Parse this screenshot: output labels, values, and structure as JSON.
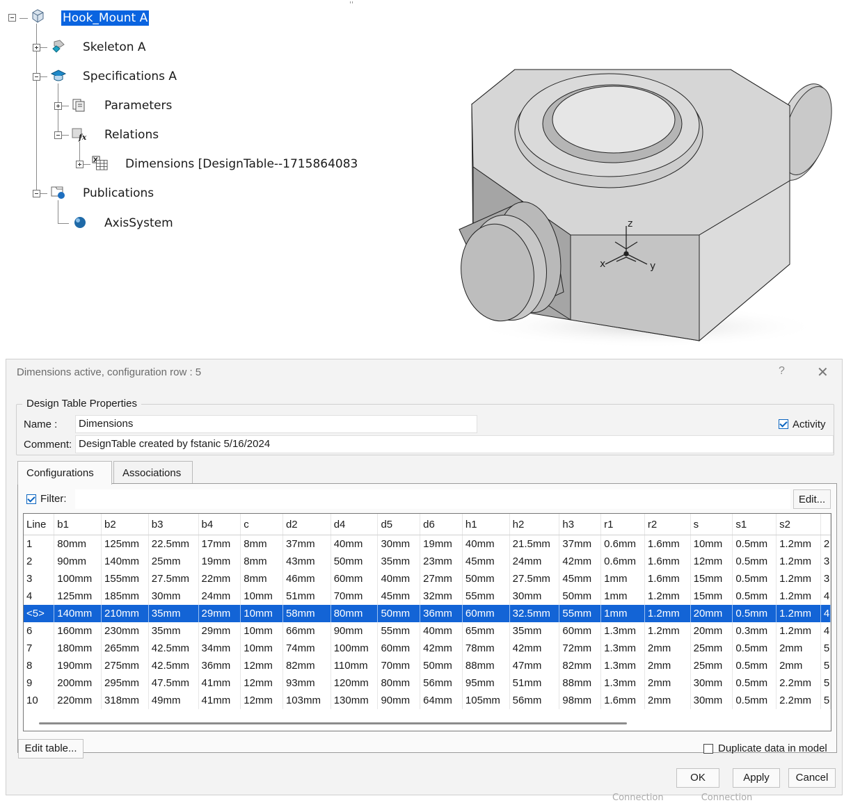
{
  "tree": {
    "root": "Hook_Mount A",
    "skeleton": "Skeleton A",
    "specifications": "Specifications A",
    "parameters": "Parameters",
    "relations": "Relations",
    "dimensions": "Dimensions [DesignTable--1715864083",
    "publications": "Publications",
    "axis_system": "AxisSystem"
  },
  "viewport": {
    "axis_x": "x",
    "axis_y": "y",
    "axis_z": "z",
    "top_marker": "''"
  },
  "dialog": {
    "title": "Dimensions active, configuration row : 5",
    "help": "?",
    "close": "✕",
    "group_title": "Design Table Properties",
    "name_label": "Name :",
    "name_value": "Dimensions",
    "comment_label": "Comment:",
    "comment_value": "DesignTable created by fstanic 5/16/2024",
    "activity_label": "Activity",
    "activity_checked": true,
    "tabs": [
      "Configurations",
      "Associations"
    ],
    "filter_label": "Filter:",
    "filter_checked": true,
    "filter_value": "",
    "edit_filter": "Edit...",
    "edit_table": "Edit table...",
    "duplicate_label": "Duplicate data in model",
    "duplicate_checked": false,
    "ok": "OK",
    "apply": "Apply",
    "cancel": "Cancel"
  },
  "table": {
    "headers": [
      "Line",
      "b1",
      "b2",
      "b3",
      "b4",
      "c",
      "d2",
      "d4",
      "d5",
      "d6",
      "h1",
      "h2",
      "h3",
      "r1",
      "r2",
      "s",
      "s1",
      "s2",
      ""
    ],
    "selected_row": 4,
    "rows": [
      [
        "1",
        "80mm",
        "125mm",
        "22.5mm",
        "17mm",
        "8mm",
        "37mm",
        "40mm",
        "30mm",
        "19mm",
        "40mm",
        "21.5mm",
        "37mm",
        "0.6mm",
        "1.6mm",
        "10mm",
        "0.5mm",
        "1.2mm",
        "2"
      ],
      [
        "2",
        "90mm",
        "140mm",
        "25mm",
        "19mm",
        "8mm",
        "43mm",
        "50mm",
        "35mm",
        "23mm",
        "45mm",
        "24mm",
        "42mm",
        "0.6mm",
        "1.6mm",
        "12mm",
        "0.5mm",
        "1.2mm",
        "3"
      ],
      [
        "3",
        "100mm",
        "155mm",
        "27.5mm",
        "22mm",
        "8mm",
        "46mm",
        "60mm",
        "40mm",
        "27mm",
        "50mm",
        "27.5mm",
        "45mm",
        "1mm",
        "1.6mm",
        "15mm",
        "0.5mm",
        "1.2mm",
        "3"
      ],
      [
        "4",
        "125mm",
        "185mm",
        "30mm",
        "24mm",
        "10mm",
        "51mm",
        "70mm",
        "45mm",
        "32mm",
        "55mm",
        "30mm",
        "50mm",
        "1mm",
        "1.2mm",
        "15mm",
        "0.5mm",
        "1.2mm",
        "4"
      ],
      [
        "<5>",
        "140mm",
        "210mm",
        "35mm",
        "29mm",
        "10mm",
        "58mm",
        "80mm",
        "50mm",
        "36mm",
        "60mm",
        "32.5mm",
        "55mm",
        "1mm",
        "1.2mm",
        "20mm",
        "0.5mm",
        "1.2mm",
        "4"
      ],
      [
        "6",
        "160mm",
        "230mm",
        "35mm",
        "29mm",
        "10mm",
        "66mm",
        "90mm",
        "55mm",
        "40mm",
        "65mm",
        "35mm",
        "60mm",
        "1.3mm",
        "1.2mm",
        "20mm",
        "0.3mm",
        "1.2mm",
        "4"
      ],
      [
        "7",
        "180mm",
        "265mm",
        "42.5mm",
        "34mm",
        "10mm",
        "74mm",
        "100mm",
        "60mm",
        "42mm",
        "78mm",
        "42mm",
        "72mm",
        "1.3mm",
        "2mm",
        "25mm",
        "0.5mm",
        "2mm",
        "5"
      ],
      [
        "8",
        "190mm",
        "275mm",
        "42.5mm",
        "36mm",
        "12mm",
        "82mm",
        "110mm",
        "70mm",
        "50mm",
        "88mm",
        "47mm",
        "82mm",
        "1.3mm",
        "2mm",
        "25mm",
        "0.5mm",
        "2mm",
        "5"
      ],
      [
        "9",
        "200mm",
        "295mm",
        "47.5mm",
        "41mm",
        "12mm",
        "93mm",
        "120mm",
        "80mm",
        "56mm",
        "95mm",
        "51mm",
        "88mm",
        "1.3mm",
        "2mm",
        "30mm",
        "0.5mm",
        "2.2mm",
        "5"
      ],
      [
        "10",
        "220mm",
        "318mm",
        "49mm",
        "41mm",
        "12mm",
        "103mm",
        "130mm",
        "90mm",
        "64mm",
        "105mm",
        "56mm",
        "98mm",
        "1.6mm",
        "2mm",
        "30mm",
        "0.5mm",
        "2.2mm",
        "5"
      ]
    ]
  },
  "background_footer": [
    "Connection",
    "Connection"
  ],
  "colors": {
    "selection": "#1364d6",
    "tree_selection": "#0a64e0",
    "dialog_bg": "#f3f3f3"
  }
}
